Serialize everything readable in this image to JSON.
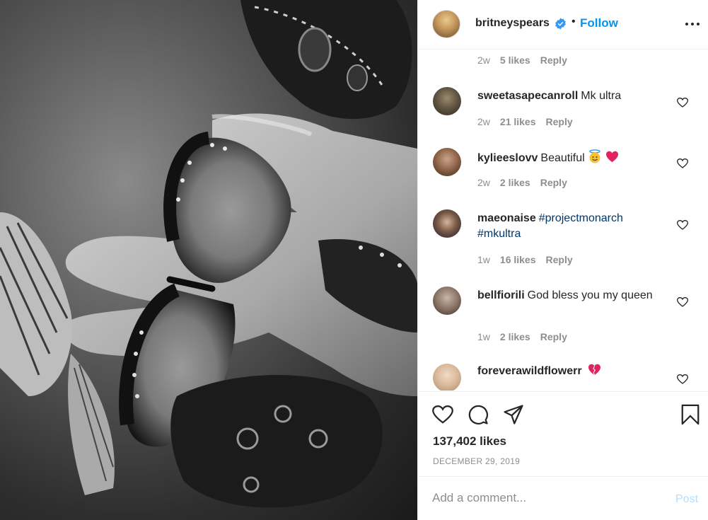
{
  "post": {
    "username": "britneyspears",
    "follow_label": "Follow",
    "separator": "•",
    "likes_text": "137,402 likes",
    "date": "DECEMBER 29, 2019",
    "image_alt": "black and white butterflies on a hand"
  },
  "partial_comment_meta": {
    "age": "2w",
    "likes": "5 likes",
    "reply": "Reply"
  },
  "comments": [
    {
      "username": "sweetasapecanroll",
      "text": "Mk ultra",
      "age": "2w",
      "likes": "21 likes",
      "reply": "Reply"
    },
    {
      "username": "kylieeslovv",
      "text": "Beautiful",
      "emojis": [
        "angel-face",
        "red-heart"
      ],
      "age": "2w",
      "likes": "2 likes",
      "reply": "Reply"
    },
    {
      "username": "maeonaise",
      "hashtags": [
        "#projectmonarch",
        "#mkultra"
      ],
      "age": "1w",
      "likes": "16 likes",
      "reply": "Reply"
    },
    {
      "username": "bellfiorili",
      "text": "God bless you my queen",
      "age": "1w",
      "likes": "2 likes",
      "reply": "Reply"
    },
    {
      "username": "foreverawildflowerr",
      "emojis": [
        "broken-heart"
      ]
    }
  ],
  "add_comment": {
    "placeholder": "Add a comment...",
    "post_label": "Post"
  },
  "colors": {
    "follow": "#0095f6",
    "hashtag": "#00376b",
    "muted": "#8e8e8e",
    "post_disabled": "#b2dffc",
    "heart_red": "#e0245e"
  },
  "icons": [
    "verified-badge-icon",
    "more-options-icon",
    "heart-icon",
    "comment-icon",
    "share-icon",
    "bookmark-icon"
  ]
}
